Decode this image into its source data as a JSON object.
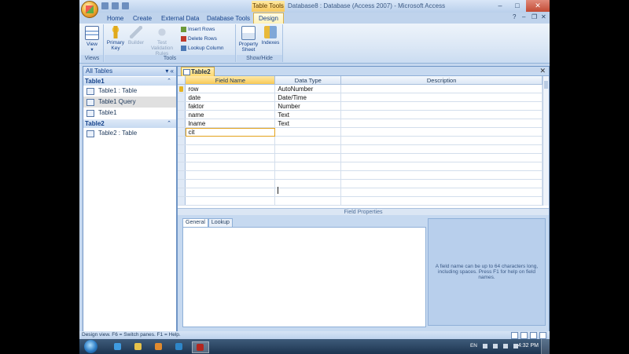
{
  "window": {
    "context_tab": "Table Tools",
    "title": "Database8 : Database (Access 2007) - Microsoft Access"
  },
  "ribbon_tabs": [
    "Home",
    "Create",
    "External Data",
    "Database Tools",
    "Design"
  ],
  "active_tab": "Design",
  "ribbon": {
    "views": {
      "label": "Views",
      "view_button": "View"
    },
    "tools": {
      "label": "Tools",
      "primary_key": "Primary Key",
      "builder": "Builder",
      "test_validation": "Test Validation Rules",
      "insert_rows": "Insert Rows",
      "delete_rows": "Delete Rows",
      "lookup_column": "Lookup Column"
    },
    "showhide": {
      "label": "Show/Hide",
      "property_sheet": "Property Sheet",
      "indexes": "Indexes"
    }
  },
  "nav": {
    "header": "All Tables",
    "groups": [
      {
        "name": "Table1",
        "items": [
          "Table1 : Table",
          "Table1 Query",
          "Table1"
        ]
      },
      {
        "name": "Table2",
        "items": [
          "Table2 : Table"
        ]
      }
    ],
    "selected_item": "Table1 Query"
  },
  "doc": {
    "tab": "Table2",
    "columns": [
      "Field Name",
      "Data Type",
      "Description"
    ],
    "rows": [
      {
        "field": "row",
        "type": "AutoNumber",
        "desc": ""
      },
      {
        "field": "date",
        "type": "Date/Time",
        "desc": ""
      },
      {
        "field": "faktor",
        "type": "Number",
        "desc": ""
      },
      {
        "field": "name",
        "type": "Text",
        "desc": ""
      },
      {
        "field": "lname",
        "type": "Text",
        "desc": ""
      },
      {
        "field": "cit",
        "type": "",
        "desc": ""
      }
    ],
    "field_properties_label": "Field Properties",
    "fp_tabs": [
      "General",
      "Lookup"
    ],
    "help_text": "A field name can be up to 64 characters long, including spaces. Press F1 for help on field names."
  },
  "status": {
    "text": "Design view.  F6 = Switch panes.  F1 = Help."
  },
  "taskbar": {
    "lang": "EN",
    "time": "4:32 PM"
  }
}
